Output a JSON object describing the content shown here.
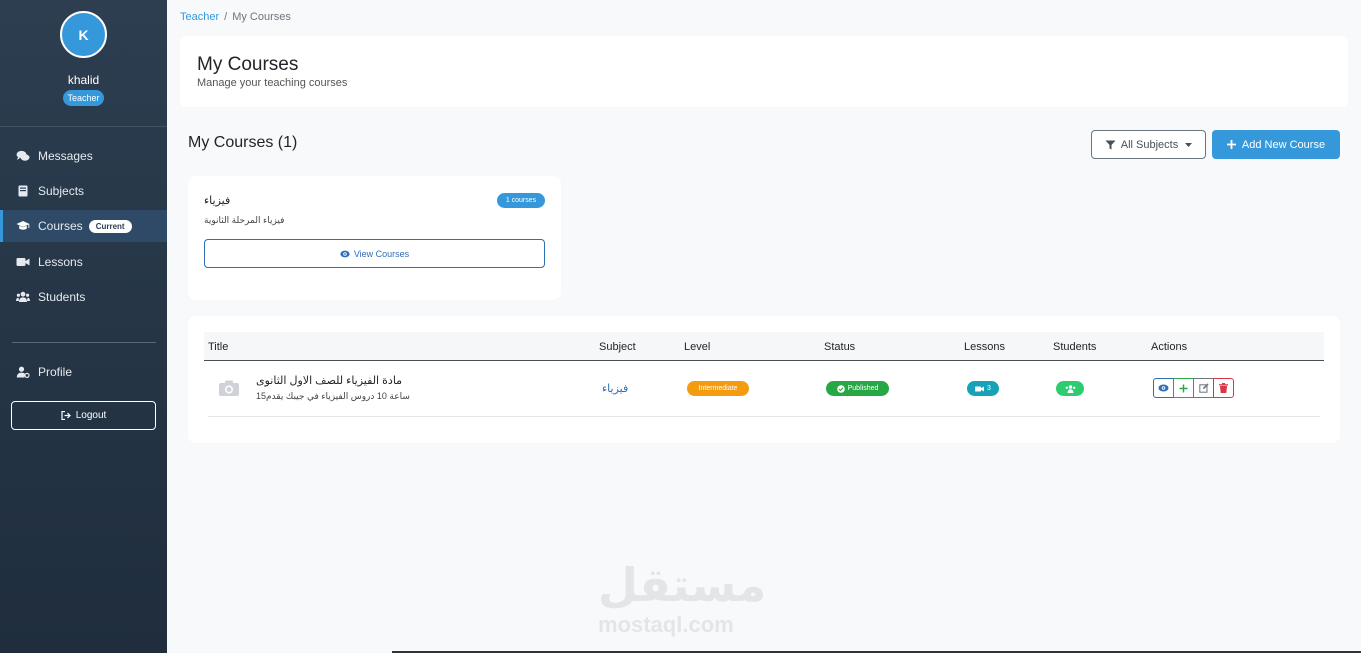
{
  "user": {
    "avatar_initial": "K",
    "name": "khalid",
    "role": "Teacher"
  },
  "sidebar": {
    "items": [
      {
        "label": "Messages",
        "icon": "comments-icon"
      },
      {
        "label": "Subjects",
        "icon": "book-icon"
      },
      {
        "label": "Courses",
        "icon": "graduation-cap-icon",
        "badge": "Current"
      },
      {
        "label": "Lessons",
        "icon": "video-icon"
      },
      {
        "label": "Students",
        "icon": "users-icon"
      }
    ],
    "profile_label": "Profile",
    "logout_label": "Logout"
  },
  "breadcrumb": {
    "parent": "Teacher",
    "separator": "/",
    "current": "My Courses"
  },
  "header": {
    "title": "My Courses",
    "subtitle": "Manage your teaching courses"
  },
  "toolbar": {
    "section_title": "My Courses (1)",
    "filter_label": "All Subjects",
    "add_label": "Add New Course"
  },
  "subject_card": {
    "name": "فيزياء",
    "description": "فيزياء المرحلة الثانوية",
    "count_badge": "1 courses",
    "view_label": "View Courses"
  },
  "table": {
    "columns": [
      "Title",
      "Subject",
      "Level",
      "Status",
      "Lessons",
      "Students",
      "Actions"
    ],
    "rows": [
      {
        "title": "مادة الفيزياء للصف الاول الثانوى",
        "description": "15ساعة 10 دروس الفيزياء في جيبك يقدم",
        "subject": "فيزياء",
        "level": "Intermediate",
        "status": "Published",
        "lessons": "3"
      }
    ]
  },
  "colors": {
    "sidebar_bg": "#2c3e50",
    "accent": "#3498db",
    "level_intermediate": "#f39c12",
    "status_published": "#28a745",
    "lessons_badge": "#17a2b8",
    "students_badge": "#2ecc71",
    "danger": "#dc3545"
  },
  "watermark": {
    "arabic": "مستقل",
    "latin": "mostaql.com"
  }
}
